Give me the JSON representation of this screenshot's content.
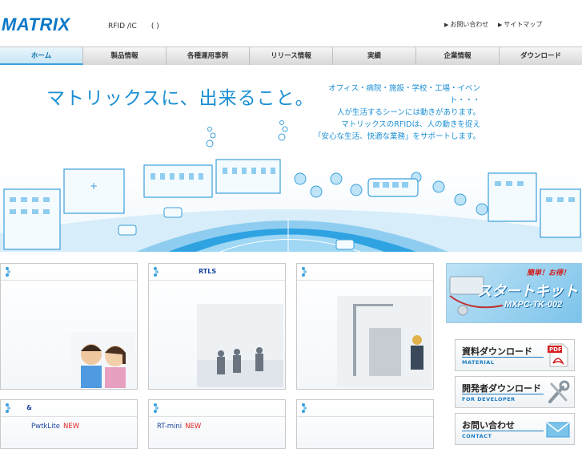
{
  "header": {
    "logo": "MATRIX",
    "tagline": "RFID /IC　　( )",
    "links": [
      {
        "label": "お問い合わせ"
      },
      {
        "label": "サイトマップ"
      }
    ]
  },
  "nav": {
    "items": [
      {
        "label": "ホーム"
      },
      {
        "label": "製品情報"
      },
      {
        "label": "各種運用事例"
      },
      {
        "label": "リリース情報"
      },
      {
        "label": "実績"
      },
      {
        "label": "企業情報"
      },
      {
        "label": "ダウンロード"
      }
    ]
  },
  "hero": {
    "title": "マトリックスに、出来ること。",
    "copy": [
      "オフィス・病院・施設・学校・工場・イベント・・・",
      "人が生活するシーンには動きがあります。",
      "マトリックスのRFIDは、人の動きを捉え",
      "「安心な生活、快適な業務」をサポートします。"
    ]
  },
  "panels": {
    "top_middle_label": "RTLS",
    "lower_left_top": "&",
    "lower_left_product": "PwtkLite",
    "lower_middle_product": "RT-mini",
    "new_badge": "NEW"
  },
  "sidebar": {
    "banner": {
      "badge": "簡単！お得！",
      "title": "スタートキット",
      "model": "MXPC-TK-002"
    },
    "buttons": [
      {
        "jp": "資料ダウンロード",
        "en": "MATERIAL",
        "icon": "pdf-icon",
        "icon_text": "PDF"
      },
      {
        "jp": "開発者ダウンロード",
        "en": "FOR DEVELOPER",
        "icon": "tools-icon"
      },
      {
        "jp": "お問い合わせ",
        "en": "CONTACT",
        "icon": "mail-icon"
      }
    ]
  },
  "colors": {
    "brand": "#0a78c8",
    "accent": "#1b8fd4",
    "new": "#e02020"
  }
}
